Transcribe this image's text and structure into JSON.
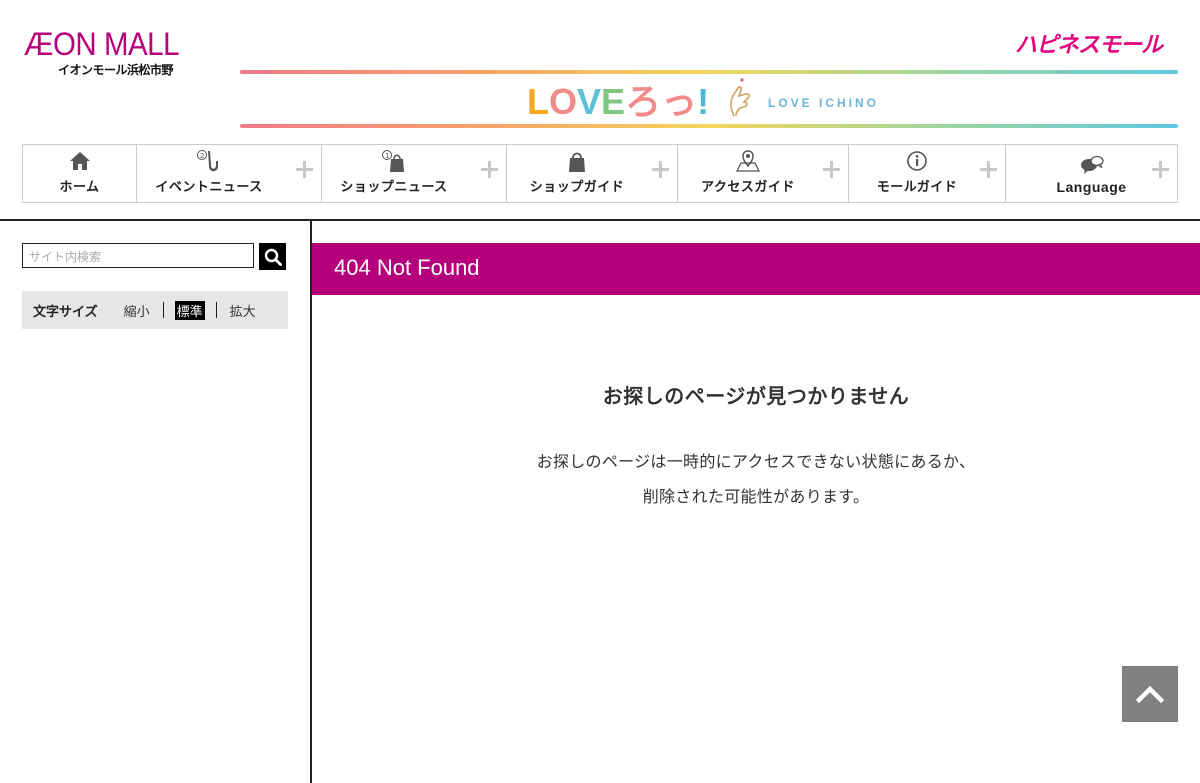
{
  "header": {
    "logo_main": "ÆON MALL",
    "logo_sub": "イオンモール浜松市野",
    "happiness_logo": "ハピネスモール",
    "banner": {
      "title_parts": [
        "L",
        "O",
        "V",
        "E",
        "ろっ",
        "!"
      ],
      "subtitle": "LOVE ICHINO"
    }
  },
  "nav": {
    "items": [
      {
        "label": "ホーム",
        "icon": "home-icon"
      },
      {
        "label": "イベントニュース",
        "icon": "saxophone-icon"
      },
      {
        "label": "ショップニュース",
        "icon": "shopping-bag-icon"
      },
      {
        "label": "ショップガイド",
        "icon": "bag-icon"
      },
      {
        "label": "アクセスガイド",
        "icon": "map-pin-icon"
      },
      {
        "label": "モールガイド",
        "icon": "info-icon"
      },
      {
        "label": "Language",
        "icon": "speech-bubble-icon"
      }
    ]
  },
  "sidebar": {
    "search_placeholder": "サイト内検索",
    "font_size": {
      "label": "文字サイズ",
      "options": [
        "縮小",
        "標準",
        "拡大"
      ],
      "selected": "標準"
    }
  },
  "main": {
    "title": "404 Not Found",
    "heading": "お探しのページが見つかりません",
    "message_line1": "お探しのページは一時的にアクセスできない状態にあるか、",
    "message_line2": "削除された可能性があります。"
  },
  "colors": {
    "brand": "#b5007b",
    "happiness": "#e4007f",
    "back_to_top": "#808080"
  }
}
